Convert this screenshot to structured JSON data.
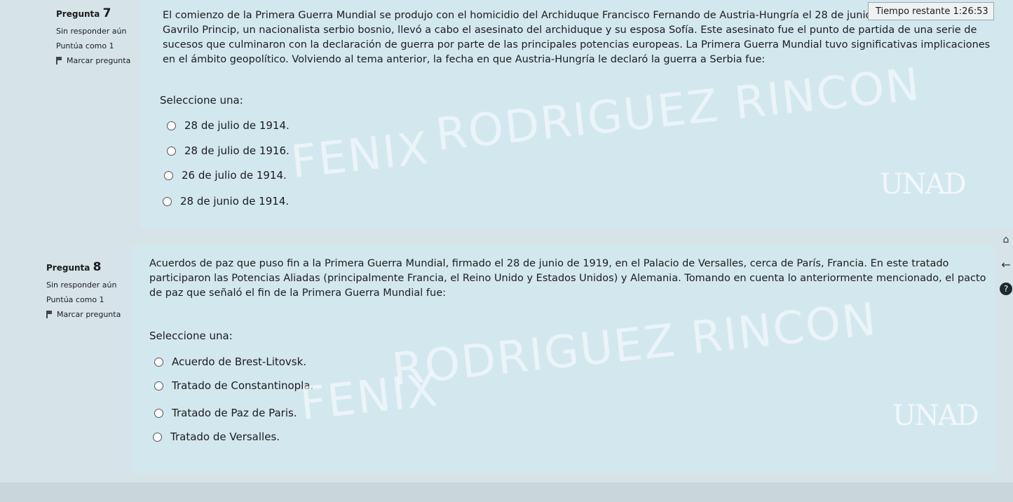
{
  "timer": {
    "label": "Tiempo restante",
    "value": "1:26:53"
  },
  "q7": {
    "label": "Pregunta",
    "number": "7",
    "status": "Sin responder aún",
    "score": "Puntúa como 1",
    "flag": "Marcar pregunta",
    "text": "El comienzo de la Primera Guerra Mundial se produjo con el homicidio del Archiduque Francisco Fernando de Austria-Hungría el 28 de junio de 1914. En Sarajevo, Gavrilo Princip, un nacionalista serbio bosnio, llevó a cabo el asesinato del archiduque y su esposa Sofía. Este asesinato fue el punto de partida de una serie de sucesos que culminaron con la declaración de guerra por parte de las principales potencias europeas. La Primera Guerra Mundial tuvo significativas implicaciones en el ámbito geopolítico. Volviendo al tema anterior, la fecha en que Austria-Hungría le declaró la guerra a Serbia fue:",
    "select_label": "Seleccione una:",
    "options": [
      "28 de julio de 1914.",
      "28 de julio de 1916.",
      "26 de julio de 1914.",
      "28 de junio de 1914."
    ]
  },
  "q8": {
    "label": "Pregunta",
    "number": "8",
    "status": "Sin responder aún",
    "score": "Puntúa como 1",
    "flag": "Marcar pregunta",
    "text": "Acuerdos de paz que puso fin a la Primera Guerra Mundial, firmado el 28 de junio de 1919, en el Palacio de Versalles, cerca de París, Francia. En este tratado participaron las Potencias Aliadas (principalmente Francia, el Reino Unido y Estados Unidos) y Alemania. Tomando en cuenta lo anteriormente mencionado, el pacto de paz que señaló el fin de la Primera Guerra Mundial fue:",
    "select_label": "Seleccione una:",
    "options": [
      "Acuerdo de Brest-Litovsk.",
      "Tratado de Constantinopla.",
      "Tratado de Paz de Paris.",
      "Tratado de Versalles."
    ]
  },
  "watermark": {
    "line1": "RODRIGUEZ RINCON",
    "line2": "FENIX",
    "logo": "UNAD"
  }
}
